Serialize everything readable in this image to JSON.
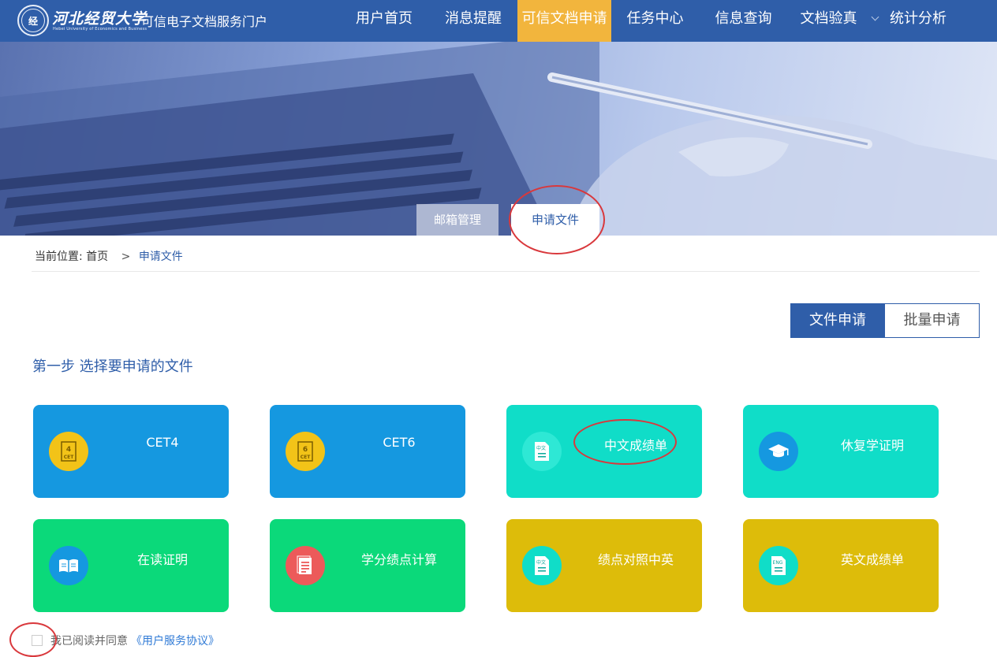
{
  "header": {
    "logo_text": "河北经贸大学",
    "logo_sub": "Hebei University of Economics and Business",
    "portal_title": "可信电子文档服务门户",
    "nav": [
      {
        "label": "用户首页"
      },
      {
        "label": "消息提醒"
      },
      {
        "label": "可信文档申请",
        "active": true
      },
      {
        "label": "任务中心"
      },
      {
        "label": "信息查询"
      },
      {
        "label": "文档验真"
      },
      {
        "label": "统计分析"
      }
    ],
    "accent_color": "#2f5ea9",
    "active_color": "#f2b53d"
  },
  "banner": {
    "tabs": [
      {
        "label": "邮箱管理"
      },
      {
        "label": "申请文件",
        "active": true
      }
    ]
  },
  "breadcrumb": {
    "prefix": "当前位置:",
    "home": "首页",
    "separator": ">",
    "current": "申请文件"
  },
  "modes": [
    {
      "label": "文件申请",
      "active": true
    },
    {
      "label": "批量申请"
    }
  ],
  "step_title": "第一步 选择要申请的文件",
  "cards": [
    {
      "label": "CET4",
      "color": "#1598e0",
      "icon": "cet4-icon",
      "icon_color": "#f2c318"
    },
    {
      "label": "CET6",
      "color": "#1598e0",
      "icon": "cet6-icon",
      "icon_color": "#f2c318"
    },
    {
      "label": "中文成绩单",
      "color": "#10ddc8",
      "icon": "chinese-transcript-icon",
      "icon_color": "#2ee8d5"
    },
    {
      "label": "休复学证明",
      "color": "#10ddc8",
      "icon": "graduation-cap-icon",
      "icon_color": "#1598e0"
    },
    {
      "label": "在读证明",
      "color": "#0bd97a",
      "icon": "open-book-icon",
      "icon_color": "#1598e0"
    },
    {
      "label": "学分绩点计算",
      "color": "#0bd97a",
      "icon": "document-lines-icon",
      "icon_color": "#ec5a5a"
    },
    {
      "label": "绩点对照中英",
      "color": "#ddbc0a",
      "icon": "chinese-doc-icon",
      "icon_color": "#10ddc8"
    },
    {
      "label": "英文成绩单",
      "color": "#ddbc0a",
      "icon": "english-doc-icon",
      "icon_color": "#10ddc8"
    }
  ],
  "agreement": {
    "text": "我已阅读并同意",
    "link": "《用户服务协议》",
    "checked": false
  }
}
